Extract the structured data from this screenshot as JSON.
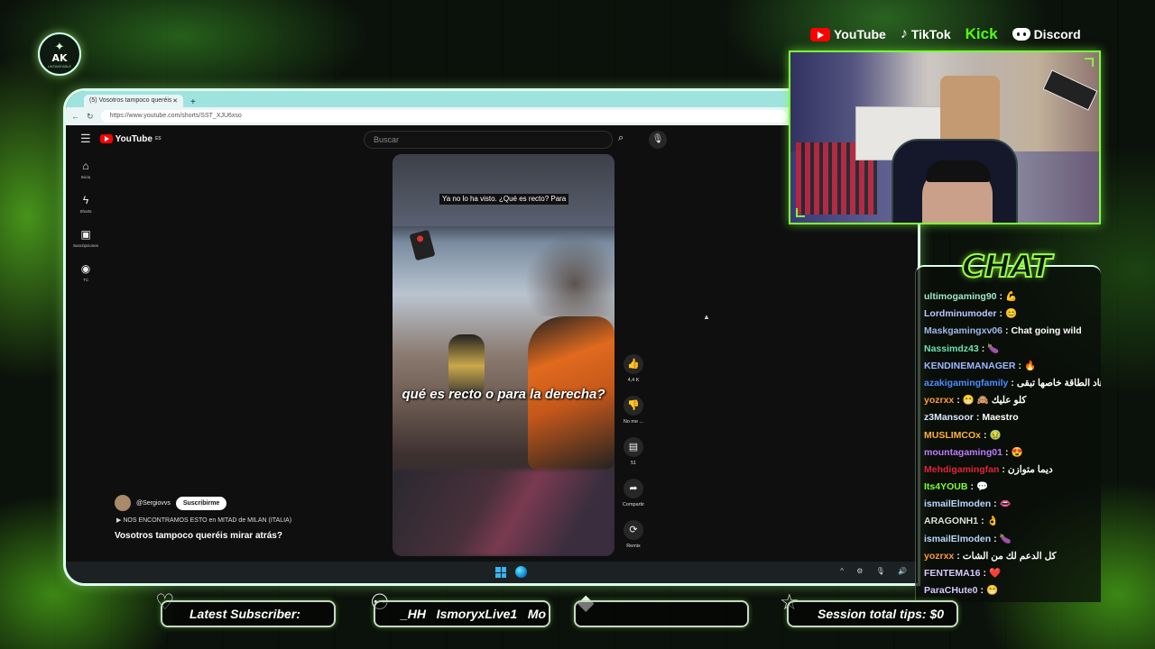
{
  "logo": {
    "text": "AK",
    "small": "UNTAKEABLE"
  },
  "socials": [
    {
      "name": "YouTube"
    },
    {
      "name": "TikTok"
    },
    {
      "name": "Kick"
    },
    {
      "name": "Discord"
    }
  ],
  "browser": {
    "tab_title": "(5) Vosotros tampoco queréis",
    "url": "https://www.youtube.com/shorts/SST_XJU6xso"
  },
  "youtube": {
    "logo_text": "YouTube",
    "region": "ES",
    "search_placeholder": "Buscar",
    "sidebar": [
      {
        "icon": "home-icon",
        "label": "Inicio"
      },
      {
        "icon": "shorts-icon",
        "label": "Shorts"
      },
      {
        "icon": "subscriptions-icon",
        "label": "Suscripciones"
      },
      {
        "icon": "you-icon",
        "label": "Tú"
      }
    ],
    "short": {
      "top_caption": "Ya no lo ha visto. ¿Qué es recto? Para",
      "subtitle": "qué es recto o para la derecha?",
      "channel": "@Sergiovvs",
      "subscribe": "Suscribirme",
      "playlist": "NOS ENCONTRAMOS ESTO en MITAD de MILAN (ITALIA)",
      "title": "Vosotros tampoco queréis mirar atrás?"
    },
    "actions": [
      {
        "icon": "like-icon",
        "label": "4,4 K"
      },
      {
        "icon": "dislike-icon",
        "label": "No me ..."
      },
      {
        "icon": "comment-icon",
        "label": "51"
      },
      {
        "icon": "share-icon",
        "label": "Compartir"
      },
      {
        "icon": "remix-icon",
        "label": "Remix"
      }
    ]
  },
  "chat": {
    "title": "CHAT",
    "messages": [
      {
        "user": "ultimogaming90",
        "color": "#9fe8c8",
        "text": "💪"
      },
      {
        "user": "Lordminumoder",
        "color": "#b9c8ff",
        "text": "😊"
      },
      {
        "user": "Maskgamingxv06",
        "color": "#9fb8e8",
        "text": "Chat going wild"
      },
      {
        "user": "Nassimdz43",
        "color": "#6ee0b0",
        "text": "🍆"
      },
      {
        "user": "KENDINEMANAGER",
        "color": "#9fb8ff",
        "text": "🔥"
      },
      {
        "user": "azakigamingfamily",
        "color": "#4f8cff",
        "text": "هاد الطاقة خاصها تبقى"
      },
      {
        "user": "yozrxx",
        "color": "#ff9a3a",
        "text": "😁 🙈 كلو عليك"
      },
      {
        "user": "z3Mansoor",
        "color": "#d8e8ff",
        "text": "Maestro"
      },
      {
        "user": "MUSLIMCOx",
        "color": "#ffb23a",
        "text": "🤢"
      },
      {
        "user": "mountagaming01",
        "color": "#c07aff",
        "text": "😍"
      },
      {
        "user": "Mehdigamingfan",
        "color": "#e0233a",
        "text": "ديما متوازن"
      },
      {
        "user": "Its4YOUB",
        "color": "#7dff3a",
        "text": "💬"
      },
      {
        "user": "ismailElmoden",
        "color": "#b9d8ff",
        "text": "👄"
      },
      {
        "user": "ARAGONH1",
        "color": "#ddd",
        "text": "👌"
      },
      {
        "user": "ismailElmoden",
        "color": "#b9d8ff",
        "text": "🍆"
      },
      {
        "user": "yozrxx",
        "color": "#ff9a3a",
        "text": "كل الدعم لك من الشات"
      },
      {
        "user": "FENTEMA16",
        "color": "#d8c8ff",
        "text": "❤️"
      },
      {
        "user": "ParaCHute0",
        "color": "#d8c8ff",
        "text": "😁"
      }
    ]
  },
  "bottom_bar": {
    "latest_subscriber_label": "Latest Subscriber:",
    "members_ticker": "_HH   IsmoryxLive1   Mo",
    "session_tips_label": "Session total tips: $0"
  }
}
